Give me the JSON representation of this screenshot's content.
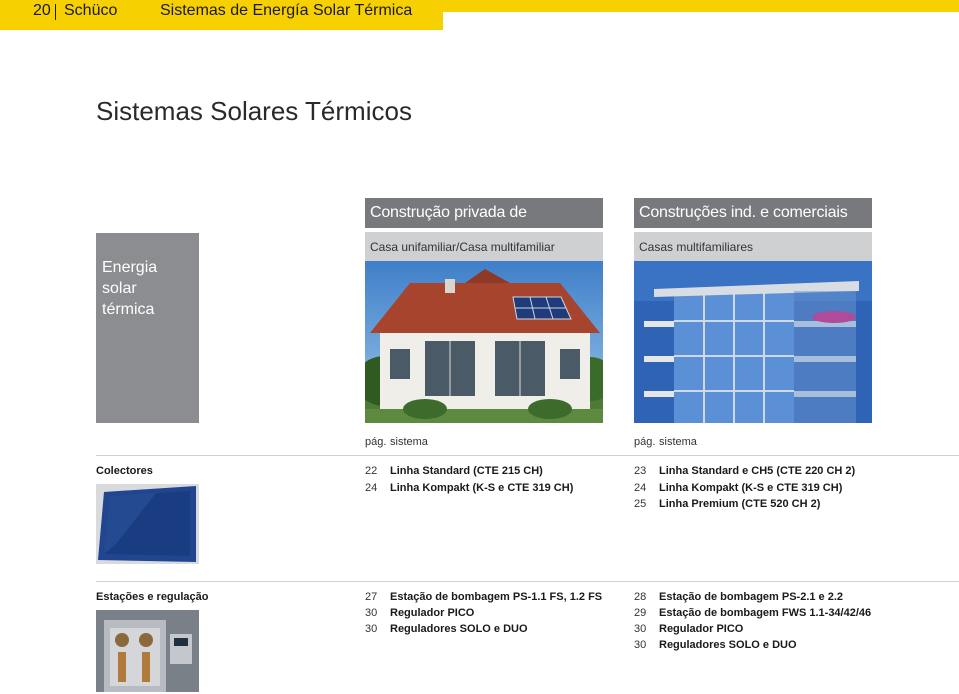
{
  "header": {
    "page_number": "20",
    "brand": "Schüco",
    "section": "Sistemas de Energía Solar Térmica"
  },
  "title": "Sistemas Solares Térmicos",
  "side_box": {
    "lines": [
      "Energia",
      "solar",
      "térmica"
    ]
  },
  "columns": [
    {
      "heading": "Construção privada de habitações",
      "subheading": "Casa unifamiliar/Casa multifamiliar pequena",
      "pag_label": "pág.",
      "sistema_label": "sistema"
    },
    {
      "heading": "Construções ind. e comerciais",
      "subheading": "Casas multifamiliares",
      "pag_label": "pág.",
      "sistema_label": "sistema"
    }
  ],
  "sections": [
    {
      "label": "Colectores",
      "col1": [
        {
          "page": "22",
          "text": "Linha Standard (CTE 215 CH)"
        },
        {
          "page": "24",
          "text": "Linha Kompakt (K-S e CTE 319 CH)"
        }
      ],
      "col2": [
        {
          "page": "23",
          "text": "Linha Standard e CH5 (CTE 220 CH 2)"
        },
        {
          "page": "24",
          "text": "Linha Kompakt (K-S e CTE 319 CH)"
        },
        {
          "page": "25",
          "text": "Linha Premium (CTE 520 CH 2)"
        }
      ]
    },
    {
      "label": "Estações e regulação",
      "col1": [
        {
          "page": "27",
          "text": "Estação de bombagem PS-1.1 FS, 1.2 FS"
        },
        {
          "page": "30",
          "text": "Regulador PICO"
        },
        {
          "page": "30",
          "text": "Reguladores SOLO e DUO"
        }
      ],
      "col2": [
        {
          "page": "28",
          "text": "Estação de bombagem PS-2.1 e 2.2"
        },
        {
          "page": "29",
          "text": "Estação de bombagem FWS 1.1-34/42/46"
        },
        {
          "page": "30",
          "text": "Regulador PICO"
        },
        {
          "page": "30",
          "text": "Reguladores SOLO e DUO"
        }
      ]
    }
  ],
  "colors": {
    "accent_yellow": "#f6d000",
    "heading_gray": "#77797c",
    "sub_gray": "#cfd0d1"
  }
}
